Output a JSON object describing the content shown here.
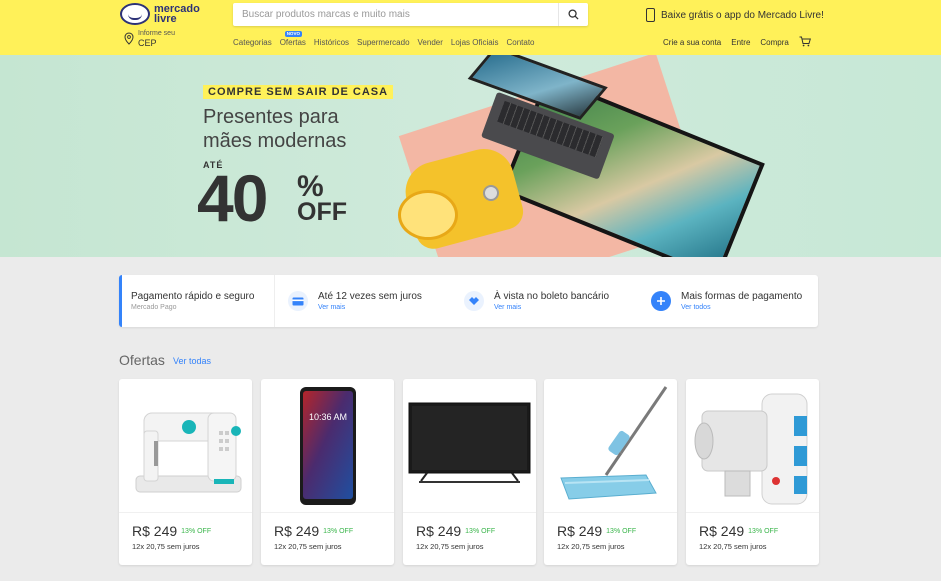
{
  "header": {
    "logo_text_1": "mercado",
    "logo_text_2": "livre",
    "search_placeholder": "Buscar produtos marcas e muito mais",
    "app_promo": "Baixe grátis o app do Mercado Livre!",
    "cep_label": "Informe seu",
    "cep_value": "CEP",
    "nav": [
      "Categorias",
      "Ofertas",
      "Históricos",
      "Supermercado",
      "Vender",
      "Lojas Oficiais",
      "Contato"
    ],
    "new_badge": "NOVO",
    "user_nav": [
      "Crie a sua conta",
      "Entre",
      "Compra"
    ],
    "colors": {
      "header_bg": "#fff159",
      "accent": "#3483fa",
      "discount": "#39b54a"
    }
  },
  "banner": {
    "tag": "COMPRE SEM SAIR DE CASA",
    "title_line1": "Presentes para",
    "title_line2": "mães modernas",
    "ate": "ATÉ",
    "discount_number": "40",
    "discount_pct": "%",
    "discount_off": "OFF"
  },
  "payment": {
    "items": [
      {
        "title": "Pagamento rápido e seguro",
        "sub": "Mercado Pago",
        "icon": "none"
      },
      {
        "title": "Até 12 vezes sem juros",
        "sub": "Ver mais",
        "icon": "credit-card-icon"
      },
      {
        "title": "À vista no boleto bancário",
        "sub": "Ver mais",
        "icon": "handshake-icon"
      },
      {
        "title": "Mais formas de pagamento",
        "sub": "Ver todos",
        "icon": "plus-icon"
      }
    ]
  },
  "offers": {
    "title": "Ofertas",
    "see_all": "Ver todas",
    "items": [
      {
        "product": "sewing-machine",
        "price": "R$ 249",
        "discount": "13% OFF",
        "installments": "12x 20,75 sem juros"
      },
      {
        "product": "smartphone",
        "price": "R$ 249",
        "discount": "13% OFF",
        "installments": "12x 20,75 sem juros",
        "screen_time": "10:36 AM"
      },
      {
        "product": "tv",
        "price": "R$ 249",
        "discount": "13% OFF",
        "installments": "12x 20,75 sem juros"
      },
      {
        "product": "spray-mop",
        "price": "R$ 249",
        "discount": "13% OFF",
        "installments": "12x 20,75 sem juros"
      },
      {
        "product": "nebulizer",
        "price": "R$ 249",
        "discount": "13% OFF",
        "installments": "12x 20,75 sem juros"
      }
    ]
  }
}
